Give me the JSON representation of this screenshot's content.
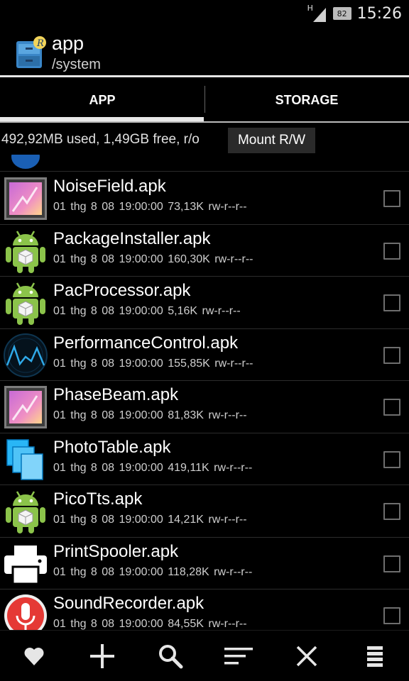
{
  "status_bar": {
    "network": "H",
    "battery": "82",
    "time": "15:26",
    "icons": [
      "signal-icon",
      "battery-icon"
    ]
  },
  "action_bar": {
    "title": "app",
    "subtitle": "/system",
    "icon": "root-explorer-app-icon"
  },
  "tabs": [
    {
      "label": "APP",
      "selected": true
    },
    {
      "label": "STORAGE",
      "selected": false
    }
  ],
  "info": {
    "text": "492,92MB used, 1,49GB free, r/o",
    "mount_button": "Mount R/W"
  },
  "files": [
    {
      "name": "NoiseField.apk",
      "meta": "01 thg 8 08 19:00:00  73,13K  rw-r--r--",
      "icon": "gallery-icon"
    },
    {
      "name": "PackageInstaller.apk",
      "meta": "01 thg 8 08 19:00:00  160,30K  rw-r--r--",
      "icon": "android-icon"
    },
    {
      "name": "PacProcessor.apk",
      "meta": "01 thg 8 08 19:00:00  5,16K  rw-r--r--",
      "icon": "android-icon"
    },
    {
      "name": "PerformanceControl.apk",
      "meta": "01 thg 8 08 19:00:00  155,85K  rw-r--r--",
      "icon": "performance-graph-icon"
    },
    {
      "name": "PhaseBeam.apk",
      "meta": "01 thg 8 08 19:00:00  81,83K  rw-r--r--",
      "icon": "gallery-icon"
    },
    {
      "name": "PhotoTable.apk",
      "meta": "01 thg 8 08 19:00:00  419,11K  rw-r--r--",
      "icon": "photo-table-icon"
    },
    {
      "name": "PicoTts.apk",
      "meta": "01 thg 8 08 19:00:00  14,21K  rw-r--r--",
      "icon": "android-icon"
    },
    {
      "name": "PrintSpooler.apk",
      "meta": "01 thg 8 08 19:00:00  118,28K  rw-r--r--",
      "icon": "printer-icon"
    },
    {
      "name": "SoundRecorder.apk",
      "meta": "01 thg 8 08 19:00:00  84,55K  rw-r--r--",
      "icon": "microphone-icon"
    }
  ],
  "toolbar": {
    "buttons": [
      "favorite-icon",
      "add-icon",
      "search-icon",
      "sort-icon",
      "close-icon",
      "menu-icon"
    ]
  },
  "colors": {
    "background": "#000000",
    "text": "#ffffff",
    "secondary_text": "#cfcfcf",
    "accent": "#e8e8e8"
  }
}
